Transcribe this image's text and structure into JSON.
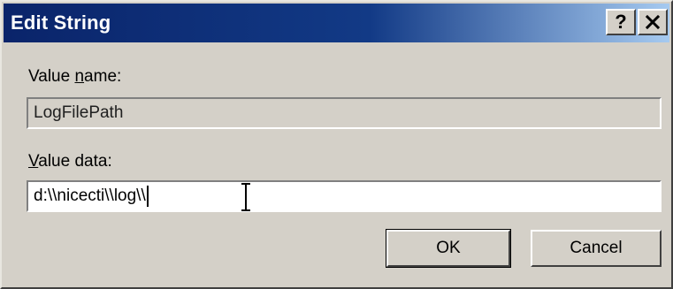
{
  "window": {
    "title": "Edit String",
    "help_button": "?",
    "close_button": "✕"
  },
  "value_name": {
    "label_prefix": "Value ",
    "label_mnemonic": "n",
    "label_suffix": "ame:",
    "value": "LogFilePath"
  },
  "value_data": {
    "label_mnemonic": "V",
    "label_suffix": "alue data:",
    "value": "d:\\\\nicecti\\\\log\\\\"
  },
  "buttons": {
    "ok": "OK",
    "cancel": "Cancel"
  },
  "colors": {
    "titlebar_start": "#0a246a",
    "titlebar_end": "#a6caf0",
    "dialog_face": "#d4d0c8"
  }
}
